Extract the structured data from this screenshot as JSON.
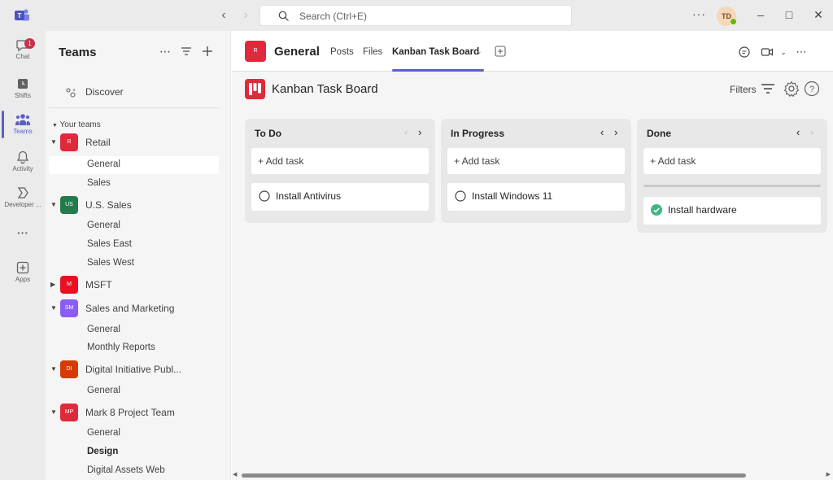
{
  "titlebar": {
    "search_placeholder": "Search (Ctrl+E)",
    "more": "···",
    "avatar_initials": "TD"
  },
  "rail": {
    "items": [
      {
        "label": "Chat",
        "icon": "chat-icon",
        "badge": "1"
      },
      {
        "label": "Shifts",
        "icon": "shifts-icon"
      },
      {
        "label": "Teams",
        "icon": "teams-icon",
        "active": true
      },
      {
        "label": "Activity",
        "icon": "bell-icon"
      },
      {
        "label": "Developer ...",
        "icon": "developer-portal-icon"
      },
      {
        "label": "···",
        "icon": "more-apps-icon"
      },
      {
        "label": "Apps",
        "icon": "apps-icon"
      }
    ]
  },
  "panel": {
    "title": "Teams",
    "discover_label": "Discover",
    "section_header": "Your teams",
    "teams": [
      {
        "initials": "R",
        "name": "Retail",
        "color": "#e0293b",
        "channels": [
          "General",
          "Sales"
        ]
      },
      {
        "initials": "US",
        "name": "U.S. Sales",
        "color": "#237b4b",
        "channels": [
          "General",
          "Sales East",
          "Sales West"
        ]
      },
      {
        "initials": "M",
        "name": "MSFT",
        "color": "#e81123",
        "channels": []
      },
      {
        "initials": "SM",
        "name": "Sales and Marketing",
        "color": "#8b5cf6",
        "channels": [
          "General",
          "Monthly Reports"
        ]
      },
      {
        "initials": "DI",
        "name": "Digital Initiative Publ...",
        "color": "#d83b01",
        "channels": [
          "General"
        ]
      },
      {
        "initials": "MP",
        "name": "Mark 8 Project Team",
        "color": "#e0293b",
        "channels": [
          "General",
          "Design",
          "Digital Assets Web"
        ]
      }
    ]
  },
  "header": {
    "channel_initial": "R",
    "channel_title": "General",
    "tabs": [
      "Posts",
      "Files",
      "Kanban Task Board"
    ],
    "active_tab": "Kanban Task Board"
  },
  "board": {
    "title": "Kanban Task Board",
    "filters_label": "Filters",
    "columns": [
      {
        "title": "To Do",
        "add_label": "+ Add task",
        "tasks": [
          {
            "title": "Install Antivirus",
            "done": false
          }
        ]
      },
      {
        "title": "In Progress",
        "add_label": "+ Add task",
        "tasks": [
          {
            "title": "Install Windows 11",
            "done": false
          }
        ]
      },
      {
        "title": "Done",
        "add_label": "+ Add task",
        "tasks": [
          {
            "title": "Install hardware",
            "done": true
          }
        ]
      }
    ]
  },
  "colors": {
    "accent": "#5b5fc7",
    "brand_red": "#e0293b",
    "done_green": "#43b581"
  }
}
